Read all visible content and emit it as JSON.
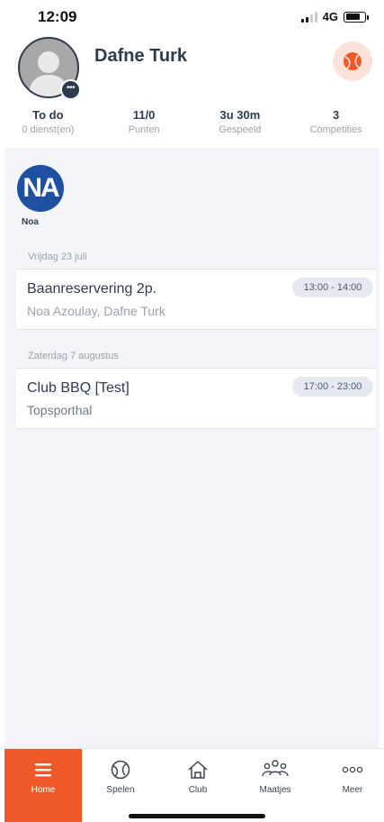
{
  "status_bar": {
    "time": "12:09",
    "network": "4G"
  },
  "profile": {
    "name": "Dafne Turk",
    "avatar_icon": "person-placeholder-icon",
    "menu_badge": "•••",
    "action_icon": "tennis-ball-icon",
    "accent_color": "#f05a28"
  },
  "stats": [
    {
      "value": "To do",
      "label": "0 dienst(en)"
    },
    {
      "value": "11/0",
      "label": "Punten"
    },
    {
      "value": "3u 30m",
      "label": "Gespeeld"
    },
    {
      "value": "3",
      "label": "Competities"
    }
  ],
  "buddies": [
    {
      "initials": "NA",
      "name": "Noa",
      "color": "#1e51a2"
    }
  ],
  "events": [
    {
      "date": "Vrijdag 23 juli",
      "title": "Baanreservering 2p.",
      "subtitle": "Noa Azoulay, Dafne Turk",
      "time": "13:00 - 14:00"
    },
    {
      "date": "Zaterdag 7 augustus",
      "title": "Club BBQ [Test]",
      "subtitle": "Topsporthal",
      "time": "17:00 - 23:00"
    }
  ],
  "tabs": [
    {
      "label": "Home",
      "icon": "menu-icon",
      "active": true
    },
    {
      "label": "Spelen",
      "icon": "tennis-ball-icon",
      "active": false
    },
    {
      "label": "Club",
      "icon": "home-icon",
      "active": false
    },
    {
      "label": "Maatjes",
      "icon": "group-icon",
      "active": false
    },
    {
      "label": "Meer",
      "icon": "more-dots-icon",
      "active": false
    }
  ]
}
